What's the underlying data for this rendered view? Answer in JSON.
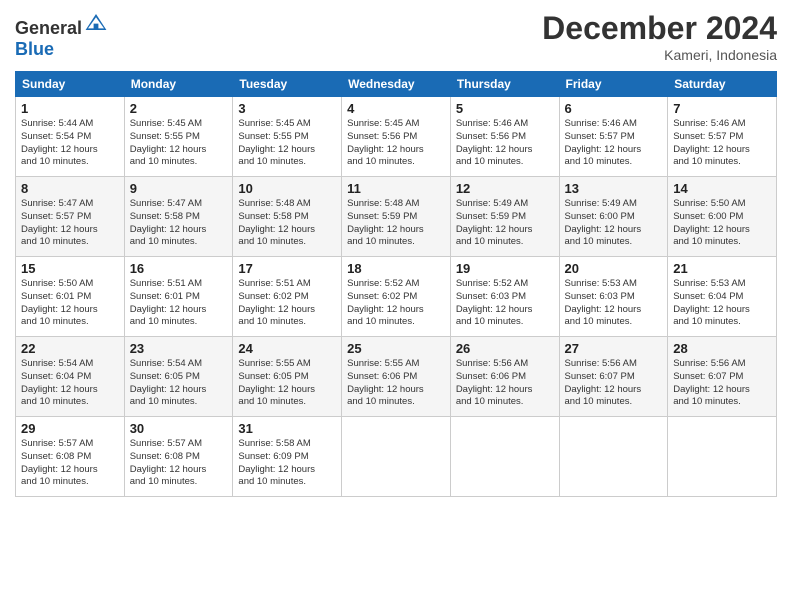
{
  "header": {
    "logo_general": "General",
    "logo_blue": "Blue",
    "title": "December 2024",
    "location": "Kameri, Indonesia"
  },
  "days_of_week": [
    "Sunday",
    "Monday",
    "Tuesday",
    "Wednesday",
    "Thursday",
    "Friday",
    "Saturday"
  ],
  "weeks": [
    [
      {
        "day": "1",
        "sunrise": "5:44 AM",
        "sunset": "5:54 PM",
        "daylight": "12 hours and 10 minutes."
      },
      {
        "day": "2",
        "sunrise": "5:45 AM",
        "sunset": "5:55 PM",
        "daylight": "12 hours and 10 minutes."
      },
      {
        "day": "3",
        "sunrise": "5:45 AM",
        "sunset": "5:55 PM",
        "daylight": "12 hours and 10 minutes."
      },
      {
        "day": "4",
        "sunrise": "5:45 AM",
        "sunset": "5:56 PM",
        "daylight": "12 hours and 10 minutes."
      },
      {
        "day": "5",
        "sunrise": "5:46 AM",
        "sunset": "5:56 PM",
        "daylight": "12 hours and 10 minutes."
      },
      {
        "day": "6",
        "sunrise": "5:46 AM",
        "sunset": "5:57 PM",
        "daylight": "12 hours and 10 minutes."
      },
      {
        "day": "7",
        "sunrise": "5:46 AM",
        "sunset": "5:57 PM",
        "daylight": "12 hours and 10 minutes."
      }
    ],
    [
      {
        "day": "8",
        "sunrise": "5:47 AM",
        "sunset": "5:57 PM",
        "daylight": "12 hours and 10 minutes."
      },
      {
        "day": "9",
        "sunrise": "5:47 AM",
        "sunset": "5:58 PM",
        "daylight": "12 hours and 10 minutes."
      },
      {
        "day": "10",
        "sunrise": "5:48 AM",
        "sunset": "5:58 PM",
        "daylight": "12 hours and 10 minutes."
      },
      {
        "day": "11",
        "sunrise": "5:48 AM",
        "sunset": "5:59 PM",
        "daylight": "12 hours and 10 minutes."
      },
      {
        "day": "12",
        "sunrise": "5:49 AM",
        "sunset": "5:59 PM",
        "daylight": "12 hours and 10 minutes."
      },
      {
        "day": "13",
        "sunrise": "5:49 AM",
        "sunset": "6:00 PM",
        "daylight": "12 hours and 10 minutes."
      },
      {
        "day": "14",
        "sunrise": "5:50 AM",
        "sunset": "6:00 PM",
        "daylight": "12 hours and 10 minutes."
      }
    ],
    [
      {
        "day": "15",
        "sunrise": "5:50 AM",
        "sunset": "6:01 PM",
        "daylight": "12 hours and 10 minutes."
      },
      {
        "day": "16",
        "sunrise": "5:51 AM",
        "sunset": "6:01 PM",
        "daylight": "12 hours and 10 minutes."
      },
      {
        "day": "17",
        "sunrise": "5:51 AM",
        "sunset": "6:02 PM",
        "daylight": "12 hours and 10 minutes."
      },
      {
        "day": "18",
        "sunrise": "5:52 AM",
        "sunset": "6:02 PM",
        "daylight": "12 hours and 10 minutes."
      },
      {
        "day": "19",
        "sunrise": "5:52 AM",
        "sunset": "6:03 PM",
        "daylight": "12 hours and 10 minutes."
      },
      {
        "day": "20",
        "sunrise": "5:53 AM",
        "sunset": "6:03 PM",
        "daylight": "12 hours and 10 minutes."
      },
      {
        "day": "21",
        "sunrise": "5:53 AM",
        "sunset": "6:04 PM",
        "daylight": "12 hours and 10 minutes."
      }
    ],
    [
      {
        "day": "22",
        "sunrise": "5:54 AM",
        "sunset": "6:04 PM",
        "daylight": "12 hours and 10 minutes."
      },
      {
        "day": "23",
        "sunrise": "5:54 AM",
        "sunset": "6:05 PM",
        "daylight": "12 hours and 10 minutes."
      },
      {
        "day": "24",
        "sunrise": "5:55 AM",
        "sunset": "6:05 PM",
        "daylight": "12 hours and 10 minutes."
      },
      {
        "day": "25",
        "sunrise": "5:55 AM",
        "sunset": "6:06 PM",
        "daylight": "12 hours and 10 minutes."
      },
      {
        "day": "26",
        "sunrise": "5:56 AM",
        "sunset": "6:06 PM",
        "daylight": "12 hours and 10 minutes."
      },
      {
        "day": "27",
        "sunrise": "5:56 AM",
        "sunset": "6:07 PM",
        "daylight": "12 hours and 10 minutes."
      },
      {
        "day": "28",
        "sunrise": "5:56 AM",
        "sunset": "6:07 PM",
        "daylight": "12 hours and 10 minutes."
      }
    ],
    [
      {
        "day": "29",
        "sunrise": "5:57 AM",
        "sunset": "6:08 PM",
        "daylight": "12 hours and 10 minutes."
      },
      {
        "day": "30",
        "sunrise": "5:57 AM",
        "sunset": "6:08 PM",
        "daylight": "12 hours and 10 minutes."
      },
      {
        "day": "31",
        "sunrise": "5:58 AM",
        "sunset": "6:09 PM",
        "daylight": "12 hours and 10 minutes."
      },
      null,
      null,
      null,
      null
    ]
  ],
  "labels": {
    "sunrise": "Sunrise:",
    "sunset": "Sunset:",
    "daylight": "Daylight:"
  }
}
